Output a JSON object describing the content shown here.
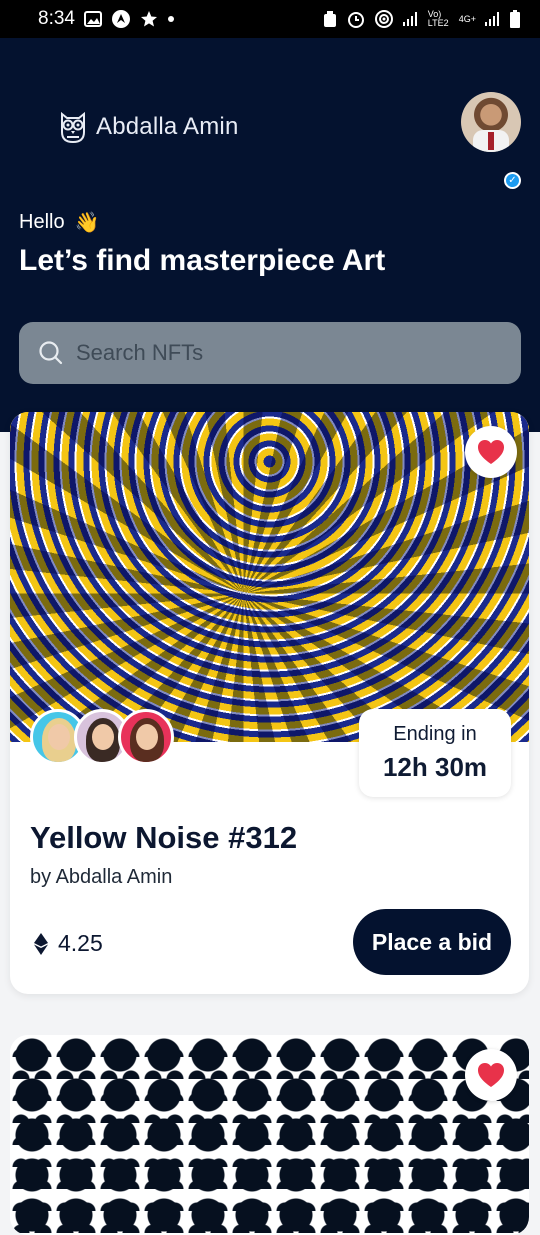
{
  "status_bar": {
    "time": "8:34",
    "icons_left": [
      "image-icon",
      "navigation-icon",
      "star-icon",
      "dot-icon"
    ],
    "icons_right": [
      "alarm-icon",
      "clock-icon",
      "hotspot-icon",
      "signal-icon",
      "volte-icon",
      "signal-4g-icon",
      "battery-icon"
    ],
    "volte_label": "Vo) LTE2",
    "network_label": "4G+"
  },
  "header": {
    "brand_name": "Abdalla Amin",
    "greeting": "Hello",
    "greeting_emoji": "👋",
    "headline": "Let’s find masterpiece Art",
    "search_placeholder": "Search NFTs"
  },
  "cards": [
    {
      "title": "Yellow Noise #312",
      "artist": "by Abdalla Amin",
      "ending_label": "Ending in",
      "ending_value": "12h 30m",
      "price": "4.25",
      "bid_label": "Place a bid",
      "favorited": true
    },
    {
      "favorited": true
    }
  ],
  "colors": {
    "navy": "#04122f",
    "accent_heart": "#e8324a",
    "search_bg": "#7b8793"
  }
}
